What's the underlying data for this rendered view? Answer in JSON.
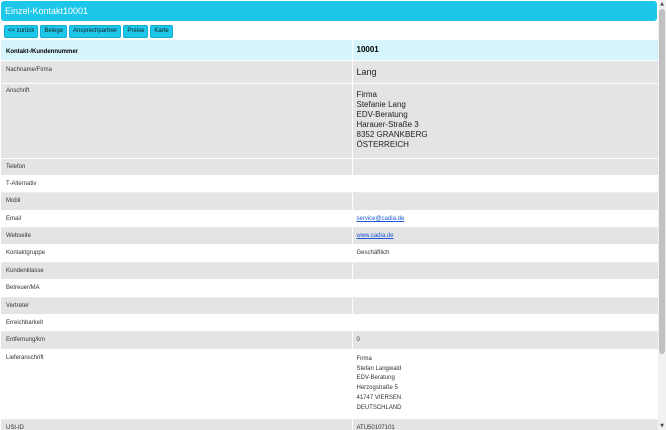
{
  "header": {
    "title": "Einzel-Kontakt10001"
  },
  "toolbar": {
    "buttons": [
      "<< zurück",
      "Belege",
      "Ansprechpartner",
      "Preise",
      "Karte"
    ]
  },
  "contact": {
    "rows": {
      "kundennummer": {
        "label": "Kontakt-/Kundennummer",
        "value": "10001"
      },
      "name": {
        "label": "Nachname/Firma",
        "value": "Lang"
      },
      "anschrift": {
        "label": "Anschrift",
        "lines": [
          "Firma",
          "Stefanie Lang",
          "EDV-Beratung",
          "Harauer-Straße 3",
          "8352 GRANKBERG",
          "ÖSTERREICH"
        ]
      },
      "telefon": {
        "label": "Telefon",
        "value": ""
      },
      "t_alternativ": {
        "label": "T-Alternativ",
        "value": ""
      },
      "mobil": {
        "label": "Mobil",
        "value": ""
      },
      "email": {
        "label": "Email",
        "value": "service@cadia.de"
      },
      "webseite": {
        "label": "Webseite",
        "value": "www.cadia.de"
      },
      "kontaktgruppe": {
        "label": "Kontaktgruppe",
        "value": "Geschäftlich"
      },
      "kundenklasse": {
        "label": "Kundenklasse",
        "value": ""
      },
      "betreuer": {
        "label": "Betreuer/MA",
        "value": ""
      },
      "vertreter": {
        "label": "Vertreter",
        "value": ""
      },
      "erreichbarkeit": {
        "label": "Erreichbarkeit",
        "value": ""
      },
      "entfernung": {
        "label": "Entfernung/km",
        "value": "0"
      },
      "lieferanschrift": {
        "label": "Lieferanschrift",
        "lines": [
          "Firma",
          "Stefan Langwald",
          "EDV-Beratung",
          "Herzogstraße 5",
          "41747 VIERSEN",
          "DEUTSCHLAND"
        ]
      },
      "ustid": {
        "label": "USt-ID",
        "value": "ATU50107101"
      }
    }
  },
  "scrollbar": {
    "up_icon": "triangle-up-icon",
    "down_icon": "triangle-down-icon"
  }
}
